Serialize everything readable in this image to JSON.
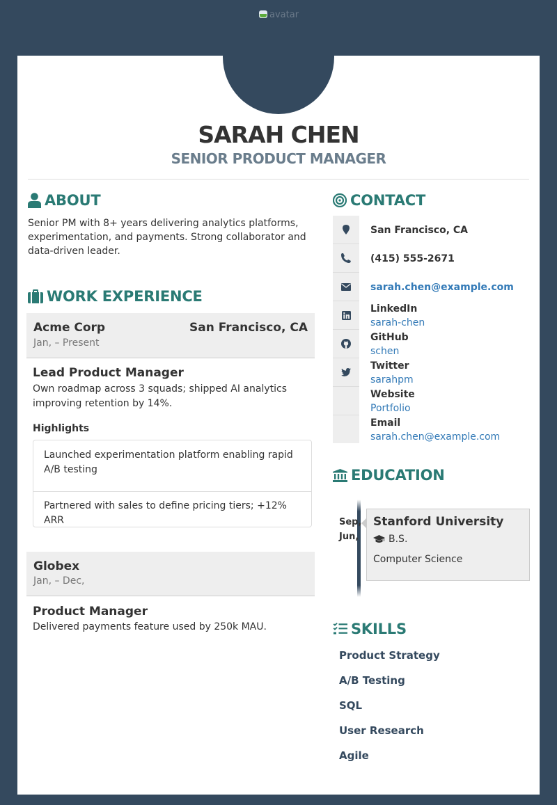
{
  "avatar": {
    "alt": "avatar",
    "icon": "broken-image-icon"
  },
  "header": {
    "name": "SARAH CHEN",
    "title": "SENIOR PRODUCT MANAGER"
  },
  "colors": {
    "background": "#34495e",
    "accent": "#2a7a74",
    "link": "#337ab7",
    "panel": "#eeeeee"
  },
  "about": {
    "heading": "ABOUT",
    "icon": "user-icon",
    "text": "Senior PM with 8+ years delivering analytics platforms, experimentation, and payments. Strong collaborator and data-driven leader."
  },
  "work": {
    "heading": "WORK EXPERIENCE",
    "icon": "briefcase-icon",
    "jobs": [
      {
        "company": "Acme Corp",
        "location": "San Francisco, CA",
        "dates": "Jan, – Present",
        "role": "Lead Product Manager",
        "description": "Own roadmap across 3 squads; shipped AI analytics improving retention by 14%.",
        "highlights_label": "Highlights",
        "highlights": [
          "Launched experimentation platform enabling rapid A/B testing",
          "Partnered with sales to define pricing tiers; +12% ARR"
        ]
      },
      {
        "company": "Globex",
        "location": "",
        "dates": "Jan, – Dec,",
        "role": "Product Manager",
        "description": "Delivered payments feature used by 250k MAU."
      }
    ]
  },
  "contact": {
    "heading": "CONTACT",
    "icon": "target-icon",
    "location": "San Francisco, CA",
    "phone": "(415) 555-2671",
    "email": "sarah.chen@example.com",
    "networks": [
      {
        "label": "LinkedIn",
        "value": "sarah-chen",
        "icon": "linkedin-icon"
      },
      {
        "label": "GitHub",
        "value": "schen",
        "icon": "github-icon"
      },
      {
        "label": "Twitter",
        "value": "sarahpm",
        "icon": "twitter-icon"
      },
      {
        "label": "Website",
        "value": "Portfolio",
        "icon": ""
      },
      {
        "label": "Email",
        "value": "sarah.chen@example.com",
        "icon": ""
      }
    ]
  },
  "education": {
    "heading": "EDUCATION",
    "icon": "institution-icon",
    "entries": [
      {
        "date_start": "Sep,",
        "date_end": "Jun,",
        "school": "Stanford University",
        "degree": "B.S.",
        "field": "Computer Science"
      }
    ]
  },
  "skills": {
    "heading": "SKILLS",
    "icon": "checklist-icon",
    "items": [
      "Product Strategy",
      "A/B Testing",
      "SQL",
      "User Research",
      "Agile"
    ]
  }
}
